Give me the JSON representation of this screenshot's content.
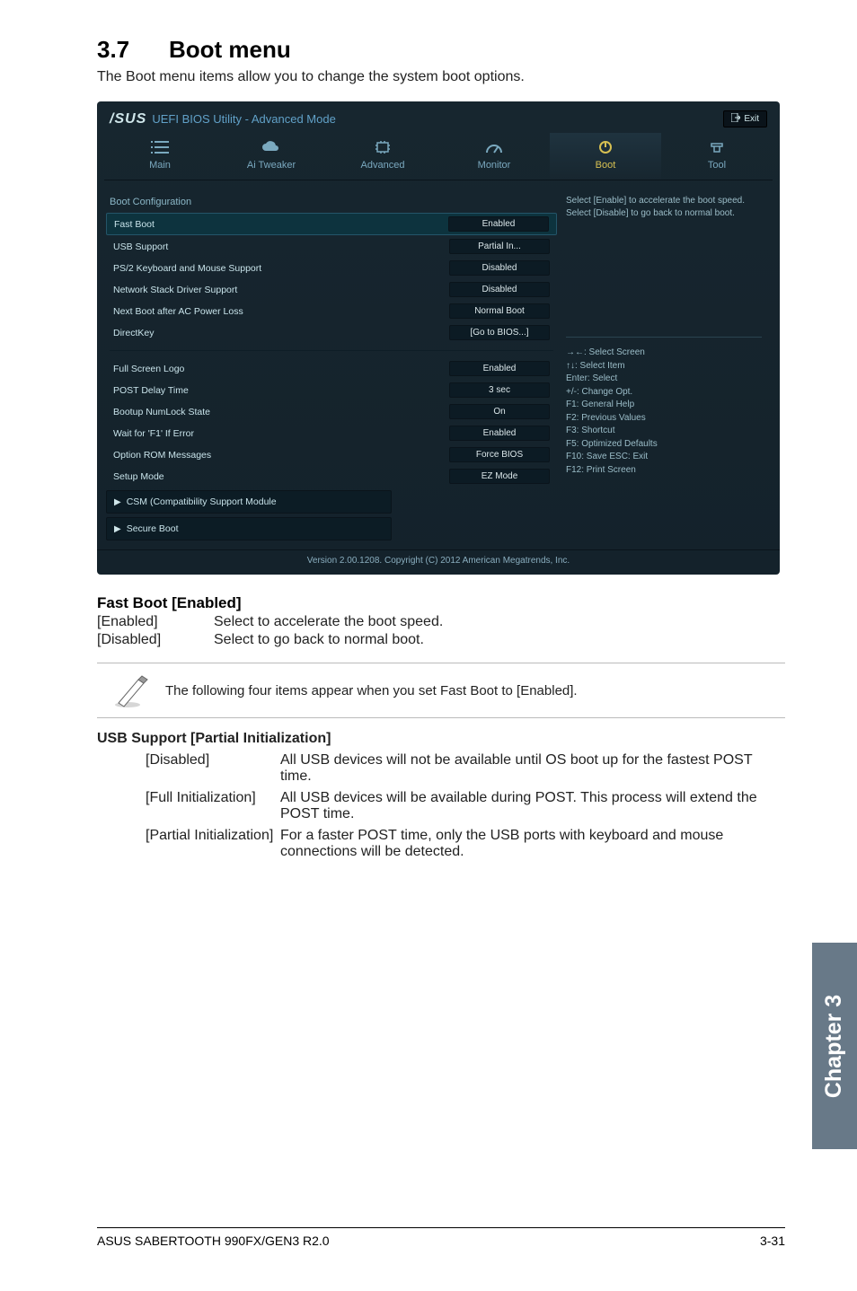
{
  "page": {
    "section_num": "3.7",
    "section_title": "Boot menu",
    "intro": "The Boot menu items allow you to change the system boot options.",
    "side_tab": "Chapter 3",
    "footer_left": "ASUS SABERTOOTH 990FX/GEN3 R2.0",
    "footer_right": "3-31"
  },
  "bios": {
    "logo_brand": "/SUS",
    "bar_title": "UEFI BIOS Utility - Advanced Mode",
    "exit_btn": "Exit",
    "tabs": {
      "main": "Main",
      "ai_tweaker": "Ai Tweaker",
      "advanced": "Advanced",
      "monitor": "Monitor",
      "boot": "Boot",
      "tool": "Tool"
    },
    "groups": {
      "boot_cfg": "Boot Configuration"
    },
    "rows": {
      "fast_boot": {
        "label": "Fast Boot",
        "value": "Enabled"
      },
      "usb_support": {
        "label": "USB Support",
        "value": "Partial In..."
      },
      "ps2": {
        "label": "PS/2 Keyboard and Mouse Support",
        "value": "Disabled"
      },
      "net_stack": {
        "label": "Network Stack Driver Support",
        "value": "Disabled"
      },
      "next_boot": {
        "label": "Next Boot after AC Power Loss",
        "value": "Normal Boot"
      },
      "directkey": {
        "label": "DirectKey",
        "value": "[Go to BIOS...]"
      },
      "full_logo": {
        "label": "Full Screen Logo",
        "value": "Enabled"
      },
      "post_delay": {
        "label": "POST Delay Time",
        "value": "3 sec"
      },
      "numlock": {
        "label": "Bootup NumLock State",
        "value": "On"
      },
      "wait_f1": {
        "label": "Wait for 'F1' If Error",
        "value": "Enabled"
      },
      "oprom": {
        "label": "Option ROM Messages",
        "value": "Force BIOS"
      },
      "setup_mode": {
        "label": "Setup Mode",
        "value": "EZ Mode"
      }
    },
    "sub": {
      "csm": "CSM (Compatibility Support Module",
      "secure_boot": "Secure Boot"
    },
    "help_text": "Select [Enable] to accelerate the boot speed. Select [Disable] to go back to normal boot.",
    "help_keys": {
      "k1": "→←: Select Screen",
      "k2": "↑↓: Select Item",
      "k3": "Enter: Select",
      "k4": "+/-: Change Opt.",
      "k5": "F1: General Help",
      "k6": "F2: Previous Values",
      "k7": "F3: Shortcut",
      "k8": "F5: Optimized Defaults",
      "k9": "F10: Save   ESC: Exit",
      "k10": "F12: Print Screen"
    },
    "footer": "Version 2.00.1208. Copyright (C) 2012 American Megatrends, Inc."
  },
  "body": {
    "fastboot_heading": "Fast Boot [Enabled]",
    "fastboot": {
      "enabled_term": "[Enabled]",
      "enabled_desc": "Select to accelerate the boot speed.",
      "disabled_term": "[Disabled]",
      "disabled_desc": "Select to go back to normal boot."
    },
    "note": "The following four items appear when you set Fast Boot to [Enabled].",
    "usb_heading": "USB Support [Partial Initialization]",
    "usb": {
      "disabled_term": "[Disabled]",
      "disabled_desc": "All USB devices will not be available until OS boot up for the fastest POST time.",
      "full_term": "[Full Initialization]",
      "full_desc": "All USB devices will be available during POST. This process will extend the POST time.",
      "partial_term": "[Partial Initialization]",
      "partial_desc": "For a faster POST time, only the USB ports with keyboard and mouse connections will be detected."
    }
  }
}
